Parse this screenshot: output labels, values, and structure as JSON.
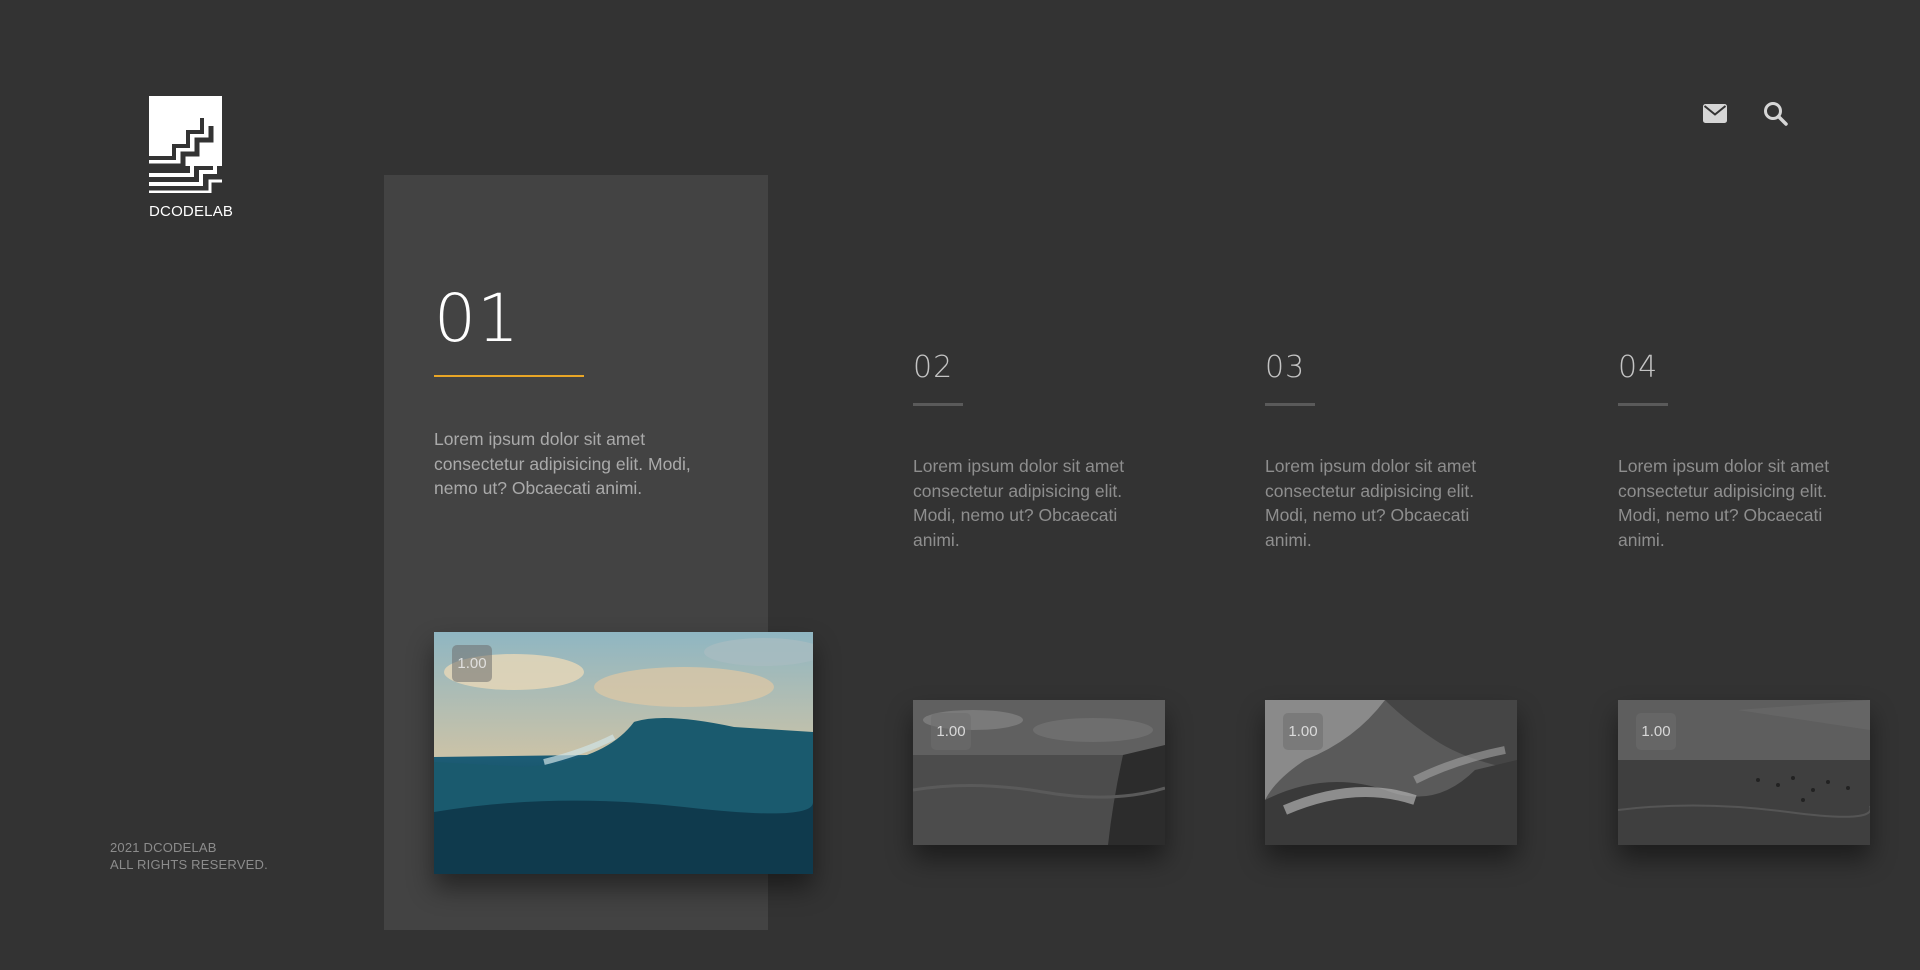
{
  "brand": {
    "name": "DCODELAB",
    "logo_icon": "stairs-logo-icon"
  },
  "header": {
    "icons": [
      "envelope-icon",
      "search-icon"
    ]
  },
  "footer": {
    "line1": "2021 DCODELAB",
    "line2": "ALL RIGHTS RESERVED."
  },
  "colors": {
    "background": "#333333",
    "active_panel": "#434343",
    "accent": "#e9a626"
  },
  "slides": [
    {
      "number": "01",
      "text": "Lorem ipsum dolor sit amet consectetur adipisicing elit. Modi, nemo ut? Obcaecati animi.",
      "badge": "1.00",
      "active": true,
      "image": "ocean wave, color"
    },
    {
      "number": "02",
      "text": "Lorem ipsum dolor sit amet consectetur adipisicing elit. Modi, nemo ut? Obcaecati animi.",
      "badge": "1.00",
      "active": false,
      "image": "sea horizon with rocks, grayscale"
    },
    {
      "number": "03",
      "text": "Lorem ipsum dolor sit amet consectetur adipisicing elit. Modi, nemo ut? Obcaecati animi.",
      "badge": "1.00",
      "active": false,
      "image": "waves crashing on rocks, grayscale"
    },
    {
      "number": "04",
      "text": "Lorem ipsum dolor sit amet consectetur adipisicing elit. Modi, nemo ut? Obcaecati animi.",
      "badge": "1.00",
      "active": false,
      "image": "swimmers in sea, grayscale"
    }
  ]
}
